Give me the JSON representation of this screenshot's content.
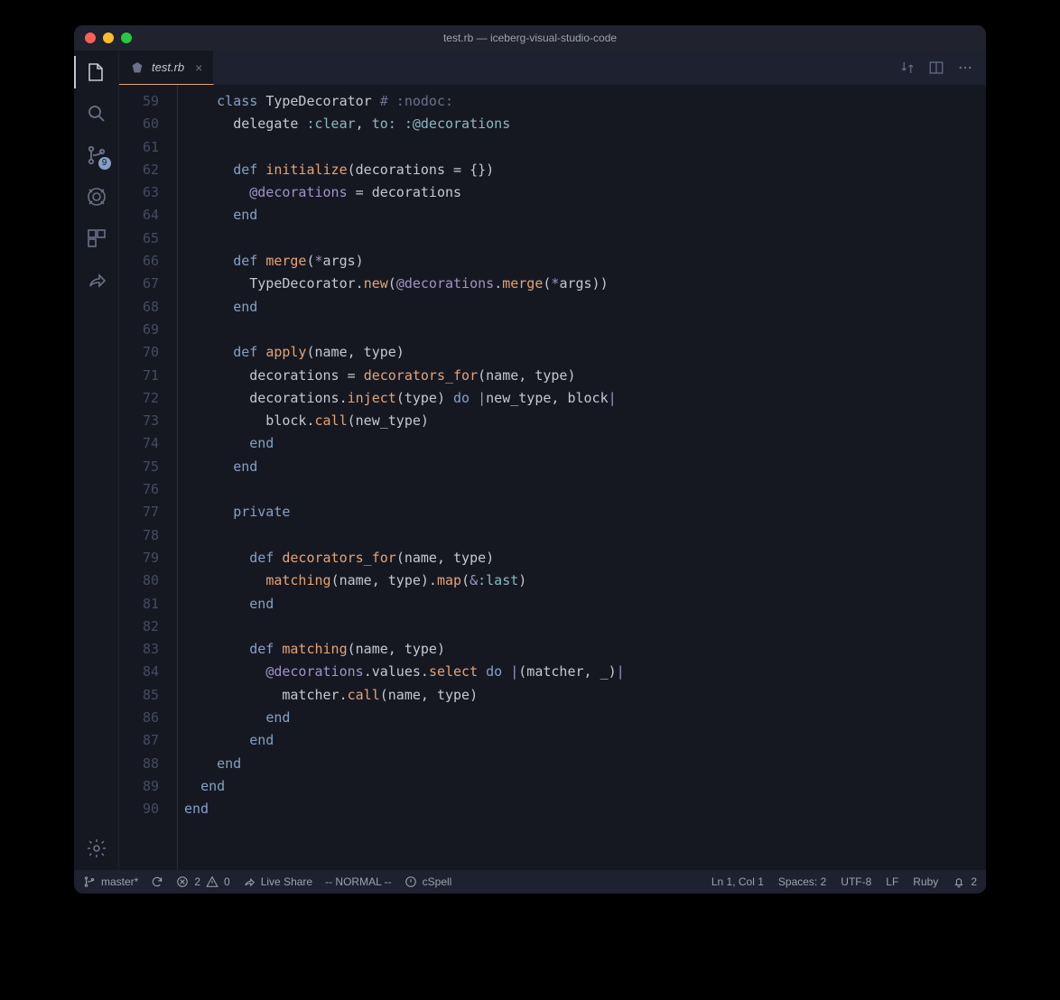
{
  "window": {
    "title": "test.rb — iceberg-visual-studio-code"
  },
  "activitybar": {
    "scm_badge": "9"
  },
  "tabs": {
    "file_label": "test.rb",
    "close_glyph": "×"
  },
  "gutter": {
    "start": 59,
    "end": 90
  },
  "status": {
    "branch": "master*",
    "errors": "2",
    "warnings": "0",
    "liveshare": "Live Share",
    "vim_mode": "-- NORMAL --",
    "cspell": "cSpell",
    "position": "Ln 1, Col 1",
    "spaces": "Spaces: 2",
    "encoding": "UTF-8",
    "eol": "LF",
    "language": "Ruby",
    "bell_count": "2"
  },
  "code_lines": [
    [
      [
        "    ",
        ""
      ],
      [
        "class",
        "kw"
      ],
      [
        " ",
        ""
      ],
      [
        "TypeDecorator",
        "const"
      ],
      [
        " ",
        ""
      ],
      [
        "# :nodoc:",
        "cm"
      ]
    ],
    [
      [
        "      ",
        ""
      ],
      [
        "delegate",
        "id"
      ],
      [
        " ",
        ""
      ],
      [
        ":clear",
        "sym"
      ],
      [
        ", ",
        ""
      ],
      [
        "to:",
        "sym"
      ],
      [
        " ",
        ""
      ],
      [
        ":@decorations",
        "sym"
      ]
    ],
    [
      [
        "",
        ""
      ]
    ],
    [
      [
        "      ",
        ""
      ],
      [
        "def",
        "kw"
      ],
      [
        " ",
        ""
      ],
      [
        "initialize",
        "fn"
      ],
      [
        "(decorations ",
        "id"
      ],
      [
        "=",
        "pn"
      ],
      [
        " ",
        "id"
      ],
      [
        "{}",
        "pn"
      ],
      [
        ")",
        ""
      ]
    ],
    [
      [
        "        ",
        ""
      ],
      [
        "@decorations",
        "var"
      ],
      [
        " ",
        "id"
      ],
      [
        "=",
        "pn"
      ],
      [
        " decorations",
        "id"
      ]
    ],
    [
      [
        "      ",
        ""
      ],
      [
        "end",
        "kw"
      ]
    ],
    [
      [
        "",
        ""
      ]
    ],
    [
      [
        "      ",
        ""
      ],
      [
        "def",
        "kw"
      ],
      [
        " ",
        ""
      ],
      [
        "merge",
        "fn"
      ],
      [
        "(",
        "pn"
      ],
      [
        "*",
        "var"
      ],
      [
        "args)",
        "id"
      ]
    ],
    [
      [
        "        ",
        ""
      ],
      [
        "TypeDecorator",
        "const"
      ],
      [
        ".",
        "pn"
      ],
      [
        "new",
        "fn"
      ],
      [
        "(",
        "pn"
      ],
      [
        "@decorations",
        "var"
      ],
      [
        ".",
        "pn"
      ],
      [
        "merge",
        "fn"
      ],
      [
        "(",
        "pn"
      ],
      [
        "*",
        "var"
      ],
      [
        "args))",
        "id"
      ]
    ],
    [
      [
        "      ",
        ""
      ],
      [
        "end",
        "kw"
      ]
    ],
    [
      [
        "",
        ""
      ]
    ],
    [
      [
        "      ",
        ""
      ],
      [
        "def",
        "kw"
      ],
      [
        " ",
        ""
      ],
      [
        "apply",
        "fn"
      ],
      [
        "(name, type)",
        "id"
      ]
    ],
    [
      [
        "        decorations ",
        "id"
      ],
      [
        "=",
        "pn"
      ],
      [
        " ",
        "id"
      ],
      [
        "decorators_for",
        "fn"
      ],
      [
        "(name, type)",
        "id"
      ]
    ],
    [
      [
        "        decorations.",
        "id"
      ],
      [
        "inject",
        "fn"
      ],
      [
        "(type) ",
        "id"
      ],
      [
        "do",
        "kw"
      ],
      [
        " ",
        "id"
      ],
      [
        "|",
        "var"
      ],
      [
        "new_type, block",
        "id"
      ],
      [
        "|",
        "var"
      ]
    ],
    [
      [
        "          block.",
        "id"
      ],
      [
        "call",
        "fn"
      ],
      [
        "(new_type)",
        "id"
      ]
    ],
    [
      [
        "        ",
        ""
      ],
      [
        "end",
        "kw"
      ]
    ],
    [
      [
        "      ",
        ""
      ],
      [
        "end",
        "kw"
      ]
    ],
    [
      [
        "",
        ""
      ]
    ],
    [
      [
        "      ",
        ""
      ],
      [
        "private",
        "kw"
      ]
    ],
    [
      [
        "",
        ""
      ]
    ],
    [
      [
        "        ",
        ""
      ],
      [
        "def",
        "kw"
      ],
      [
        " ",
        ""
      ],
      [
        "decorators_for",
        "fn"
      ],
      [
        "(name, type)",
        "id"
      ]
    ],
    [
      [
        "          ",
        ""
      ],
      [
        "matching",
        "fn"
      ],
      [
        "(name, type).",
        "id"
      ],
      [
        "map",
        "fn"
      ],
      [
        "(",
        "pn"
      ],
      [
        "&",
        "var"
      ],
      [
        ":last",
        "sym"
      ],
      [
        ")",
        "pn"
      ]
    ],
    [
      [
        "        ",
        ""
      ],
      [
        "end",
        "kw"
      ]
    ],
    [
      [
        "",
        ""
      ]
    ],
    [
      [
        "        ",
        ""
      ],
      [
        "def",
        "kw"
      ],
      [
        " ",
        ""
      ],
      [
        "matching",
        "fn"
      ],
      [
        "(name, type)",
        "id"
      ]
    ],
    [
      [
        "          ",
        ""
      ],
      [
        "@decorations",
        "var"
      ],
      [
        ".values.",
        "id"
      ],
      [
        "select",
        "fn"
      ],
      [
        " ",
        "id"
      ],
      [
        "do",
        "kw"
      ],
      [
        " ",
        "id"
      ],
      [
        "|",
        "var"
      ],
      [
        "(matcher, _)",
        "id"
      ],
      [
        "|",
        "var"
      ]
    ],
    [
      [
        "            matcher.",
        "id"
      ],
      [
        "call",
        "fn"
      ],
      [
        "(name, type)",
        "id"
      ]
    ],
    [
      [
        "          ",
        ""
      ],
      [
        "end",
        "kw"
      ]
    ],
    [
      [
        "        ",
        ""
      ],
      [
        "end",
        "kw"
      ]
    ],
    [
      [
        "    ",
        ""
      ],
      [
        "end",
        "kw"
      ]
    ],
    [
      [
        "  ",
        ""
      ],
      [
        "end",
        "kw"
      ]
    ],
    [
      [
        "",
        ""
      ],
      [
        "end",
        "kw"
      ]
    ]
  ]
}
